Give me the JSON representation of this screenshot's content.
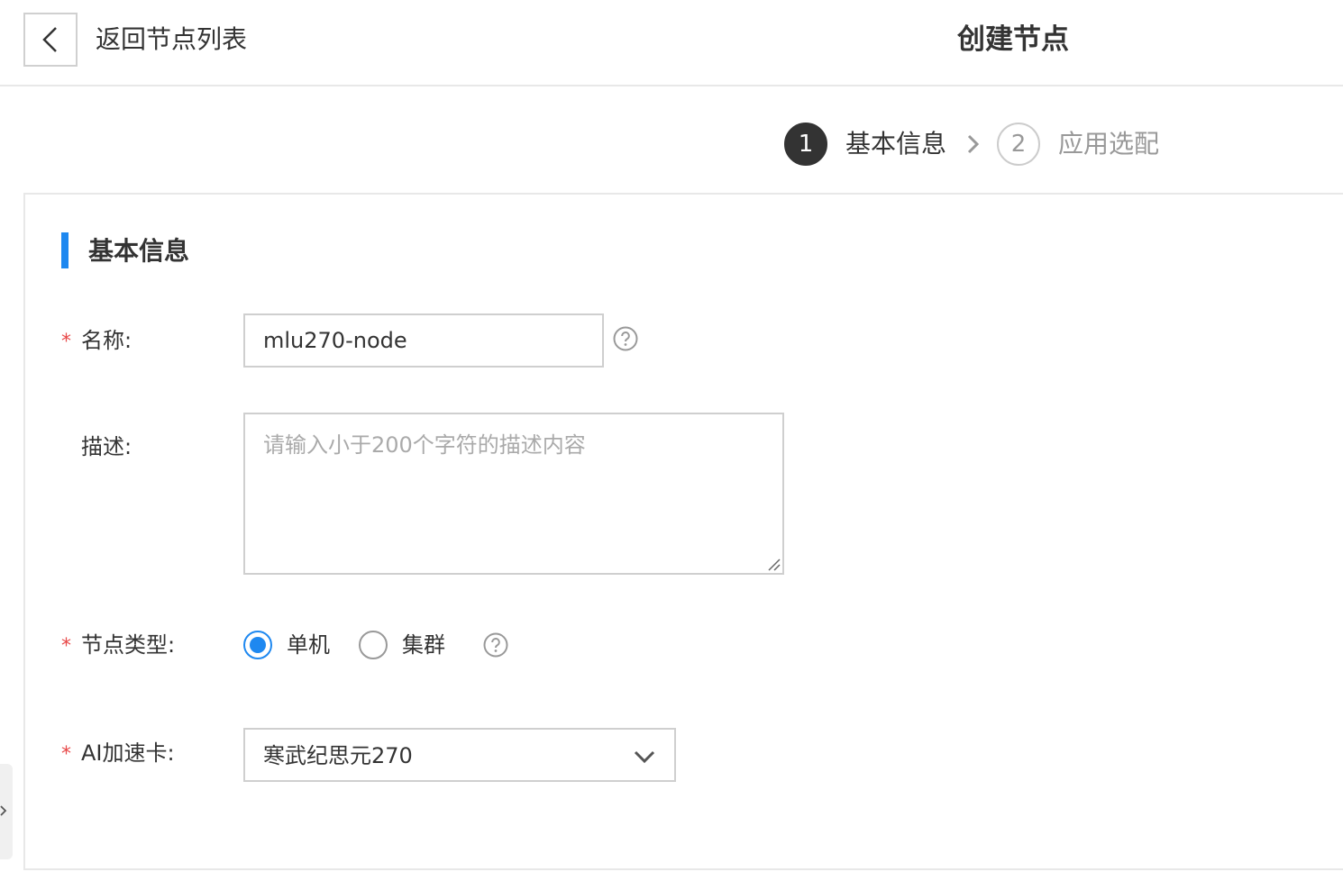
{
  "header": {
    "back_label": "返回节点列表",
    "title": "创建节点"
  },
  "steps": [
    {
      "number": "1",
      "label": "基本信息",
      "state": "active"
    },
    {
      "number": "2",
      "label": "应用选配",
      "state": "inactive"
    }
  ],
  "section": {
    "title": "基本信息"
  },
  "form": {
    "name": {
      "label": "名称:",
      "required": true,
      "value": "mlu270-node"
    },
    "description": {
      "label": "描述:",
      "required": false,
      "value": "",
      "placeholder": "请输入小于200个字符的描述内容"
    },
    "node_type": {
      "label": "节点类型:",
      "required": true,
      "options": [
        "单机",
        "集群"
      ],
      "selected": "单机"
    },
    "ai_card": {
      "label": "AI加速卡:",
      "required": true,
      "value": "寒武纪思元270"
    },
    "required_mark": "*"
  },
  "colors": {
    "accent": "#1e88f0",
    "required": "#e84848",
    "step_active": "#333333",
    "muted": "#999999"
  },
  "icons": [
    "back-arrow-icon",
    "chevron-right-icon",
    "help-icon",
    "chevron-down-icon",
    "resize-grip-icon",
    "expand-sidebar-icon"
  ]
}
